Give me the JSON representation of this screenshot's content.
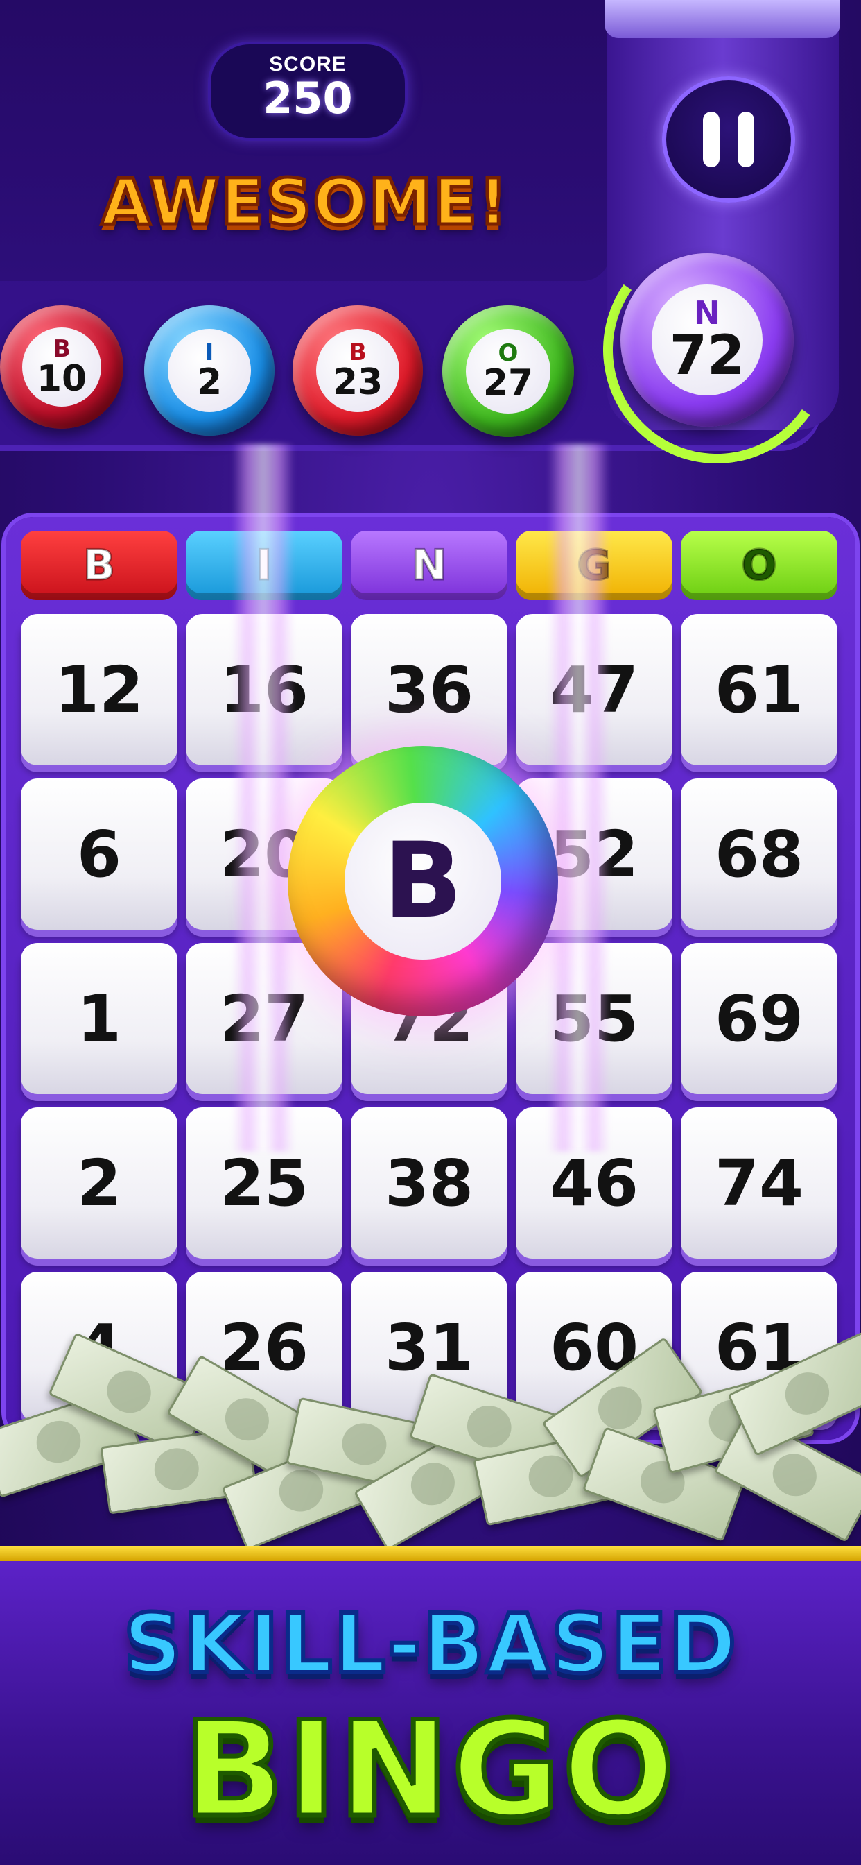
{
  "hud": {
    "score_label": "SCORE",
    "score_value": "250",
    "praise": "AWESOME!",
    "pause_icon": "pause-icon"
  },
  "called_balls": [
    {
      "letter": "B",
      "number": "10",
      "color": "#c0102a"
    },
    {
      "letter": "I",
      "number": "2",
      "color": "#1a8fe8"
    },
    {
      "letter": "B",
      "number": "23",
      "color": "#e01b2a"
    },
    {
      "letter": "O",
      "number": "27",
      "color": "#3fb81f"
    }
  ],
  "current_ball": {
    "letter": "N",
    "number": "72",
    "color": "#8a3cf0",
    "timer_color": "#b6ff3a"
  },
  "card": {
    "headers": [
      {
        "label": "B",
        "color": "#e0202a"
      },
      {
        "label": "I",
        "color": "#27b4f0"
      },
      {
        "label": "N",
        "color": "#9a4be8"
      },
      {
        "label": "G",
        "color": "#ffd21a"
      },
      {
        "label": "O",
        "color": "#8be02a"
      }
    ],
    "rows": [
      [
        "12",
        "16",
        "36",
        "47",
        "61"
      ],
      [
        "6",
        "20",
        "",
        "52",
        "68"
      ],
      [
        "1",
        "27",
        "72",
        "55",
        "69"
      ],
      [
        "2",
        "25",
        "38",
        "46",
        "74"
      ],
      [
        "4",
        "26",
        "31",
        "60",
        "61"
      ]
    ]
  },
  "power_ball": {
    "letter": "B"
  },
  "tagline": {
    "line1": "SKILL-BASED",
    "line2": "BINGO"
  }
}
